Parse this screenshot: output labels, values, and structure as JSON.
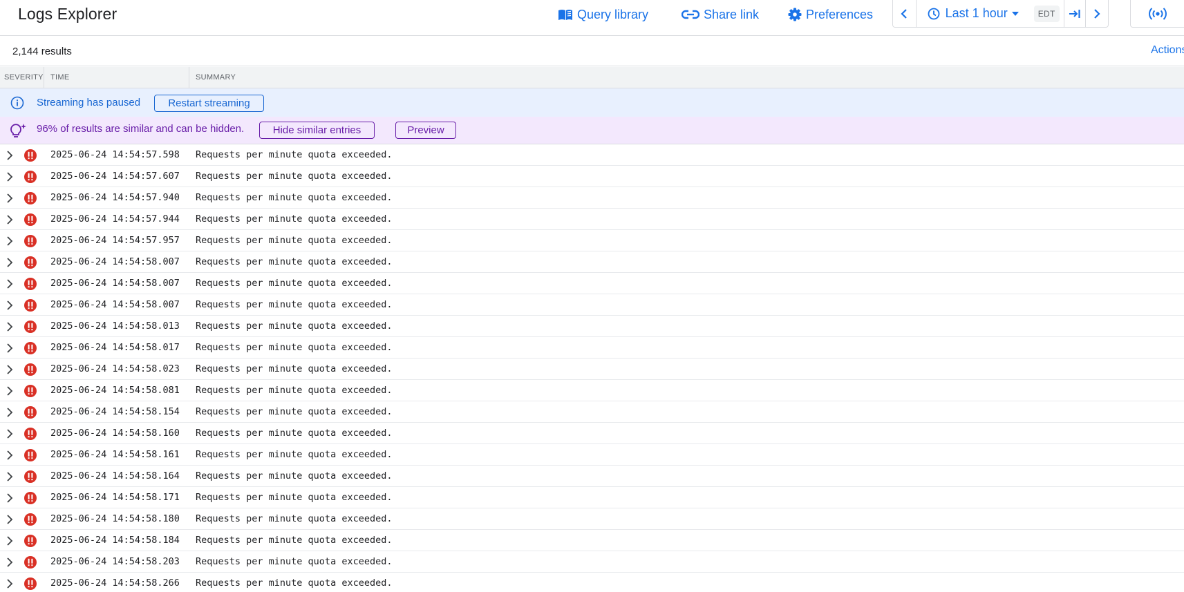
{
  "header": {
    "title": "Logs Explorer",
    "query_library": "Query library",
    "share_link": "Share link",
    "preferences": "Preferences",
    "time_range": "Last 1 hour",
    "timezone": "EDT"
  },
  "results": {
    "count": "2,144 results",
    "actions": "Actions"
  },
  "columns": {
    "severity": "SEVERITY",
    "time": "TIME",
    "summary": "SUMMARY"
  },
  "streaming_banner": {
    "text": "Streaming has paused",
    "button": "Restart streaming"
  },
  "similar_banner": {
    "text": "96% of results are similar and can be hidden.",
    "hide_button": "Hide similar entries",
    "preview_button": "Preview"
  },
  "colors": {
    "accent": "#1a73e8",
    "error": "#d93025",
    "purple": "#681da8"
  },
  "logs": [
    {
      "time": "2025-06-24 14:54:57.598",
      "summary": "Requests per minute quota exceeded.",
      "severity": "error"
    },
    {
      "time": "2025-06-24 14:54:57.607",
      "summary": "Requests per minute quota exceeded.",
      "severity": "error"
    },
    {
      "time": "2025-06-24 14:54:57.940",
      "summary": "Requests per minute quota exceeded.",
      "severity": "error"
    },
    {
      "time": "2025-06-24 14:54:57.944",
      "summary": "Requests per minute quota exceeded.",
      "severity": "error"
    },
    {
      "time": "2025-06-24 14:54:57.957",
      "summary": "Requests per minute quota exceeded.",
      "severity": "error"
    },
    {
      "time": "2025-06-24 14:54:58.007",
      "summary": "Requests per minute quota exceeded.",
      "severity": "error"
    },
    {
      "time": "2025-06-24 14:54:58.007",
      "summary": "Requests per minute quota exceeded.",
      "severity": "error"
    },
    {
      "time": "2025-06-24 14:54:58.007",
      "summary": "Requests per minute quota exceeded.",
      "severity": "error"
    },
    {
      "time": "2025-06-24 14:54:58.013",
      "summary": "Requests per minute quota exceeded.",
      "severity": "error"
    },
    {
      "time": "2025-06-24 14:54:58.017",
      "summary": "Requests per minute quota exceeded.",
      "severity": "error"
    },
    {
      "time": "2025-06-24 14:54:58.023",
      "summary": "Requests per minute quota exceeded.",
      "severity": "error"
    },
    {
      "time": "2025-06-24 14:54:58.081",
      "summary": "Requests per minute quota exceeded.",
      "severity": "error"
    },
    {
      "time": "2025-06-24 14:54:58.154",
      "summary": "Requests per minute quota exceeded.",
      "severity": "error"
    },
    {
      "time": "2025-06-24 14:54:58.160",
      "summary": "Requests per minute quota exceeded.",
      "severity": "error"
    },
    {
      "time": "2025-06-24 14:54:58.161",
      "summary": "Requests per minute quota exceeded.",
      "severity": "error"
    },
    {
      "time": "2025-06-24 14:54:58.164",
      "summary": "Requests per minute quota exceeded.",
      "severity": "error"
    },
    {
      "time": "2025-06-24 14:54:58.171",
      "summary": "Requests per minute quota exceeded.",
      "severity": "error"
    },
    {
      "time": "2025-06-24 14:54:58.180",
      "summary": "Requests per minute quota exceeded.",
      "severity": "error"
    },
    {
      "time": "2025-06-24 14:54:58.184",
      "summary": "Requests per minute quota exceeded.",
      "severity": "error"
    },
    {
      "time": "2025-06-24 14:54:58.203",
      "summary": "Requests per minute quota exceeded.",
      "severity": "error"
    },
    {
      "time": "2025-06-24 14:54:58.266",
      "summary": "Requests per minute quota exceeded.",
      "severity": "error"
    }
  ]
}
